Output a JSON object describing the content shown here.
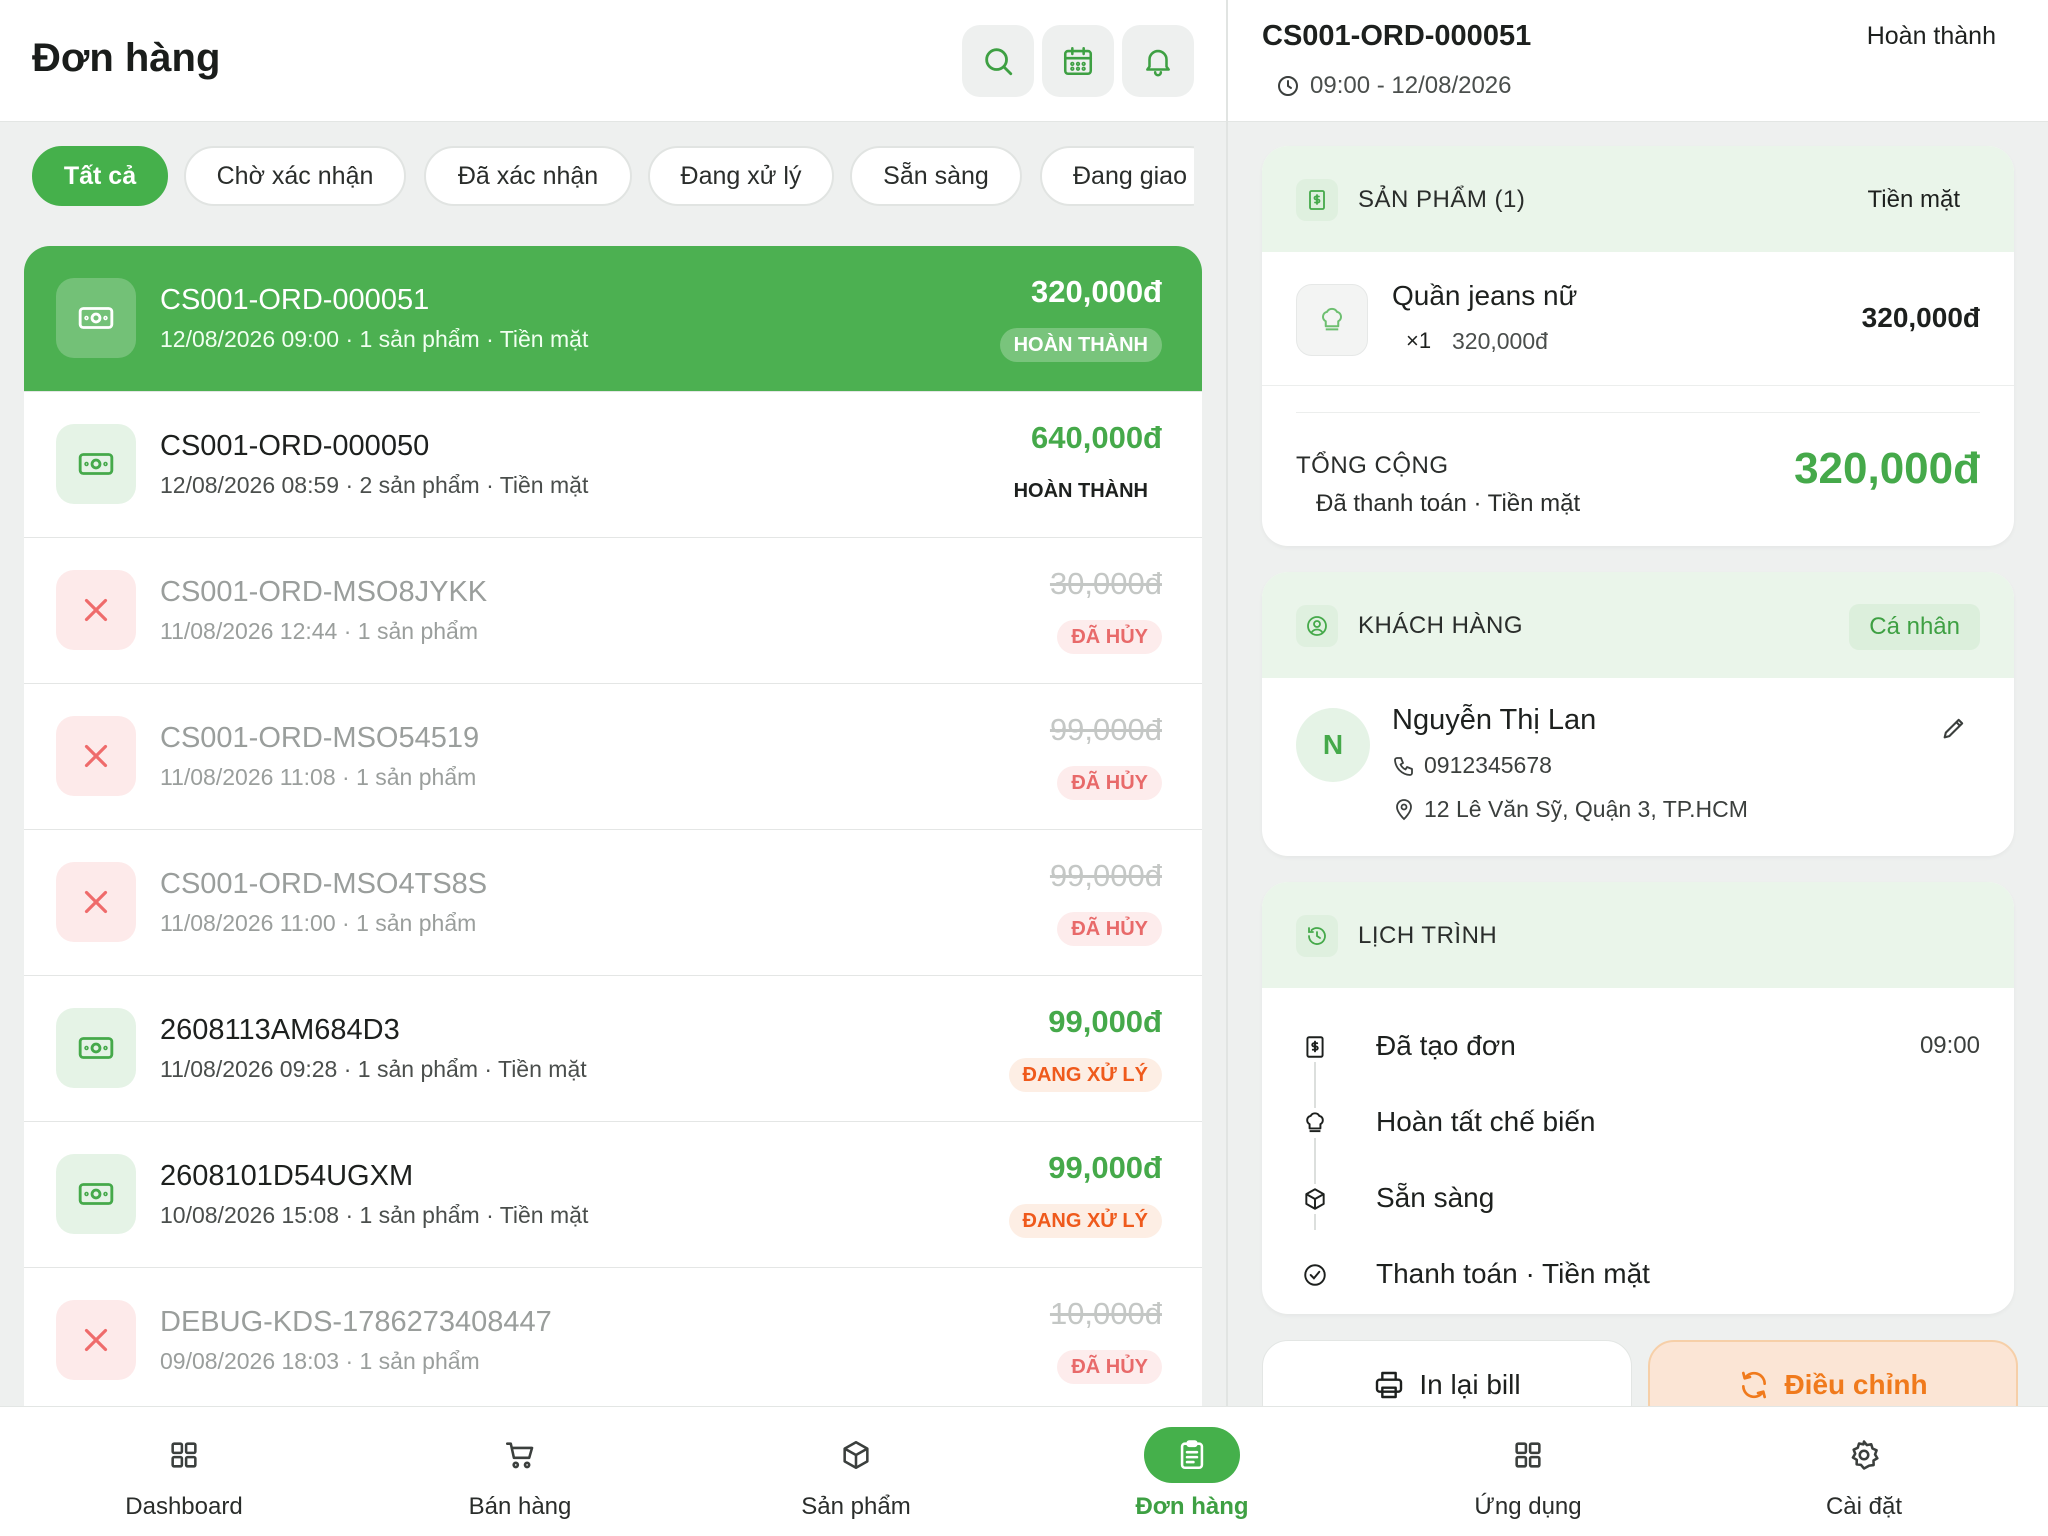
{
  "header": {
    "title": "Đơn hàng"
  },
  "icons": {
    "search": "search-icon",
    "calendar": "calendar-icon",
    "bell": "bell-icon"
  },
  "colors": {
    "accent": "#45b04b",
    "processing": "#ef5a1c",
    "cancel": "#e86a6a",
    "adjust": "#f07a1c"
  },
  "filters": [
    {
      "label": "Tất cả",
      "active": true
    },
    {
      "label": "Chờ xác nhận",
      "active": false
    },
    {
      "label": "Đã xác nhận",
      "active": false
    },
    {
      "label": "Đang xử lý",
      "active": false
    },
    {
      "label": "Sẵn sàng",
      "active": false
    },
    {
      "label": "Đang giao",
      "active": false
    }
  ],
  "orders": [
    {
      "id": "CS001-ORD-000051",
      "meta": "12/08/2026 09:00 · 1 sản phẩm · Tiền mặt",
      "price": "320,000đ",
      "status": "HOÀN THÀNH",
      "kind": "done",
      "selected": true
    },
    {
      "id": "CS001-ORD-000050",
      "meta": "12/08/2026 08:59 · 2 sản phẩm · Tiền mặt",
      "price": "640,000đ",
      "status": "HOÀN THÀNH",
      "kind": "done",
      "selected": false
    },
    {
      "id": "CS001-ORD-MSO8JYKK",
      "meta": "11/08/2026 12:44 · 1 sản phẩm",
      "price": "30,000đ",
      "status": "ĐÃ HỦY",
      "kind": "cancel",
      "selected": false
    },
    {
      "id": "CS001-ORD-MSO54519",
      "meta": "11/08/2026 11:08 · 1 sản phẩm",
      "price": "99,000đ",
      "status": "ĐÃ HỦY",
      "kind": "cancel",
      "selected": false
    },
    {
      "id": "CS001-ORD-MSO4TS8S",
      "meta": "11/08/2026 11:00 · 1 sản phẩm",
      "price": "99,000đ",
      "status": "ĐÃ HỦY",
      "kind": "cancel",
      "selected": false
    },
    {
      "id": "2608113AM684D3",
      "meta": "11/08/2026 09:28 · 1 sản phẩm · Tiền mặt",
      "price": "99,000đ",
      "status": "ĐANG XỬ LÝ",
      "kind": "processing",
      "selected": false
    },
    {
      "id": "2608101D54UGXM",
      "meta": "10/08/2026 15:08 · 1 sản phẩm · Tiền mặt",
      "price": "99,000đ",
      "status": "ĐANG XỬ LÝ",
      "kind": "processing",
      "selected": false
    },
    {
      "id": "DEBUG-KDS-1786273408447",
      "meta": "09/08/2026 18:03 · 1 sản phẩm",
      "price": "10,000đ",
      "status": "ĐÃ HỦY",
      "kind": "cancel",
      "selected": false
    }
  ],
  "detail": {
    "id": "CS001-ORD-000051",
    "status": "Hoàn thành",
    "time": "09:00 - 12/08/2026",
    "products": {
      "title": "SẢN PHẨM (1)",
      "payment": "Tiền mặt",
      "items": [
        {
          "name": "Quần jeans nữ",
          "qty": "×1",
          "unit_price": "320,000đ",
          "total": "320,000đ"
        }
      ],
      "total_label": "TỔNG CỘNG",
      "total_sub": "Đã thanh toán · Tiền mặt",
      "total_amount": "320,000đ"
    },
    "customer": {
      "title": "KHÁCH HÀNG",
      "type": "Cá nhân",
      "initial": "N",
      "name": "Nguyễn Thị Lan",
      "phone": "0912345678",
      "address": "12 Lê Văn Sỹ, Quận 3, TP.HCM"
    },
    "timeline": {
      "title": "LỊCH TRÌNH",
      "items": [
        {
          "label": "Đã tạo đơn",
          "time": "09:00",
          "icon": "receipt-icon"
        },
        {
          "label": "Hoàn tất chế biến",
          "time": "",
          "icon": "chef-hat-icon"
        },
        {
          "label": "Sẵn sàng",
          "time": "",
          "icon": "package-icon"
        },
        {
          "label": "Thanh toán · Tiền mặt",
          "time": "",
          "icon": "check-circle-icon"
        }
      ]
    },
    "actions": {
      "print": "In lại bill",
      "adjust": "Điều chỉnh"
    }
  },
  "nav": [
    {
      "label": "Dashboard",
      "icon": "grid-icon",
      "active": false
    },
    {
      "label": "Bán hàng",
      "icon": "cart-icon",
      "active": false
    },
    {
      "label": "Sản phẩm",
      "icon": "box-icon",
      "active": false
    },
    {
      "label": "Đơn hàng",
      "icon": "clipboard-icon",
      "active": true
    },
    {
      "label": "Ứng dụng",
      "icon": "apps-icon",
      "active": false
    },
    {
      "label": "Cài đặt",
      "icon": "settings-icon",
      "active": false
    }
  ]
}
